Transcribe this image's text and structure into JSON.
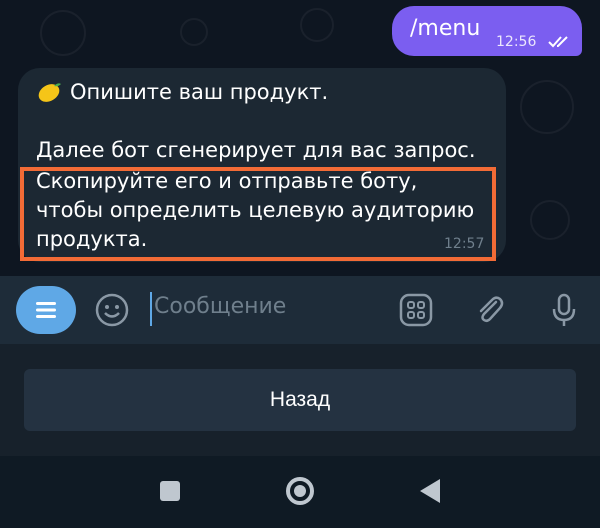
{
  "messages": {
    "outgoing": {
      "text": "/menu",
      "time": "12:56",
      "status_icon": "double-check-icon"
    },
    "incoming": {
      "icon": "lemon-icon",
      "title": "Опишите ваш продукт.",
      "lines": [
        "Далее бот сгенерирует для вас запрос.",
        "Скопируйте его и отправьте боту,",
        "чтобы определить целевую аудиторию",
        "продукта."
      ],
      "time": "12:57",
      "highlight_color": "#f26b36"
    }
  },
  "input_bar": {
    "menu_icon": "menu-icon",
    "emoji_icon": "smiley-icon",
    "placeholder": "Сообщение",
    "attach_grid_icon": "grid-icon",
    "attach_icon": "paperclip-icon",
    "mic_icon": "microphone-icon"
  },
  "keyboard": {
    "button_label": "Назад"
  },
  "colors": {
    "outgoing_bubble": "#7b5ef0",
    "accent": "#5fa8e6",
    "incoming_bubble": "#1c2833"
  }
}
